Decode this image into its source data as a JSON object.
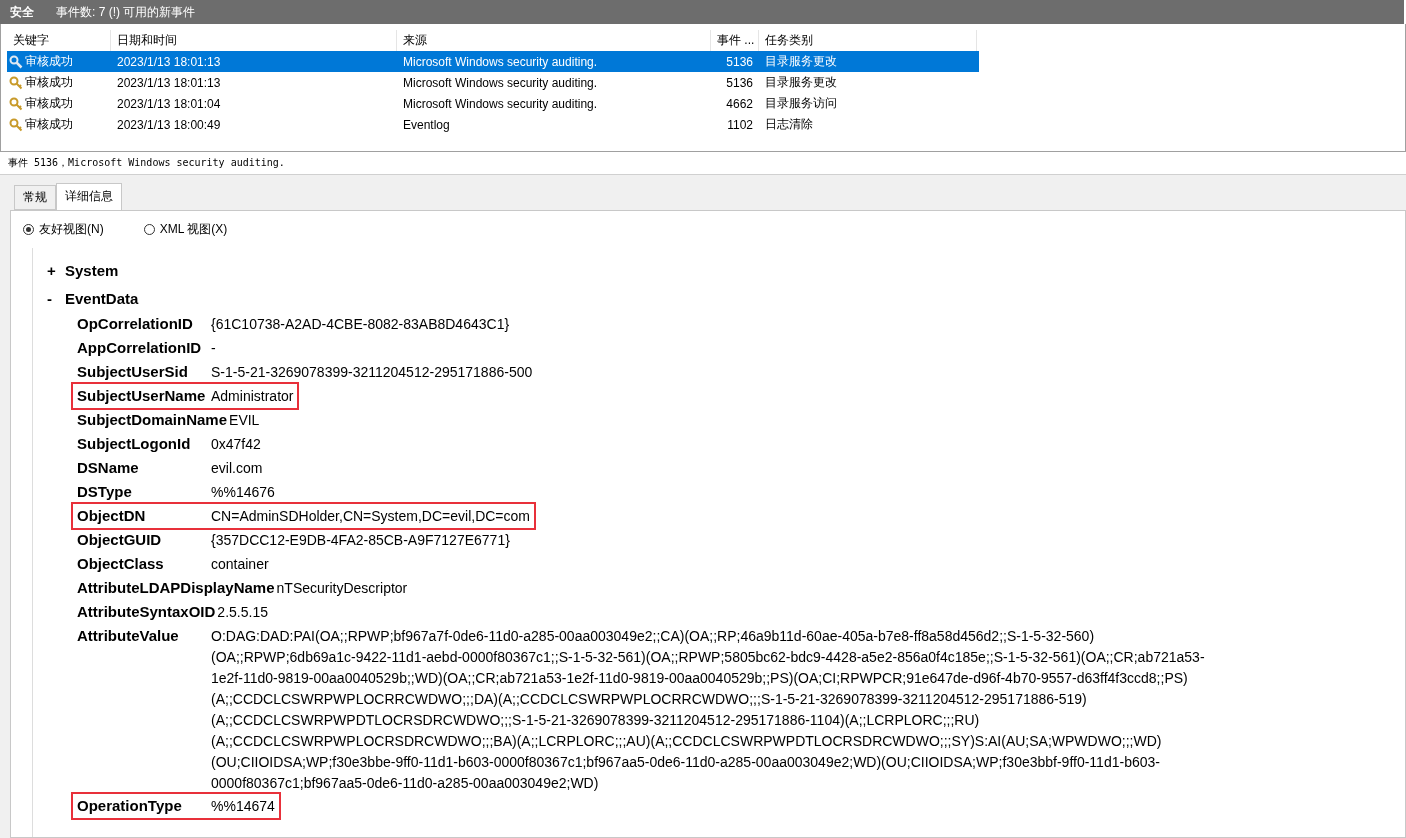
{
  "header": {
    "title": "安全",
    "summary": "事件数: 7 (!) 可用的新事件"
  },
  "table": {
    "columns": [
      "关键字",
      "日期和时间",
      "来源",
      "事件 ...",
      "任务类别"
    ],
    "rows": [
      {
        "keyword": "审核成功",
        "datetime": "2023/1/13 18:01:13",
        "source": "Microsoft Windows security auditing.",
        "event_id": "5136",
        "category": "目录服务更改",
        "selected": true
      },
      {
        "keyword": "审核成功",
        "datetime": "2023/1/13 18:01:13",
        "source": "Microsoft Windows security auditing.",
        "event_id": "5136",
        "category": "目录服务更改",
        "selected": false
      },
      {
        "keyword": "审核成功",
        "datetime": "2023/1/13 18:01:04",
        "source": "Microsoft Windows security auditing.",
        "event_id": "4662",
        "category": "目录服务访问",
        "selected": false
      },
      {
        "keyword": "审核成功",
        "datetime": "2023/1/13 18:00:49",
        "source": "Eventlog",
        "event_id": "1102",
        "category": "日志清除",
        "selected": false
      }
    ]
  },
  "detail_title": "事件 5136，Microsoft Windows security auditing.",
  "tabs": [
    {
      "label": "常规",
      "selected": false
    },
    {
      "label": "详细信息",
      "selected": true
    }
  ],
  "view_options": [
    {
      "label": "友好视图(N)",
      "selected": true
    },
    {
      "label": "XML 视图(X)",
      "selected": false
    }
  ],
  "tree": [
    {
      "toggle": "+",
      "label": "System"
    },
    {
      "toggle": "-",
      "label": "EventData",
      "fields": [
        {
          "name": "OpCorrelationID",
          "value": [
            "{61C10738-A2AD-4CBE-8082-83AB8D4643C1}"
          ],
          "highlighted": false
        },
        {
          "name": "AppCorrelationID",
          "value": [
            "-"
          ],
          "highlighted": false
        },
        {
          "name": "SubjectUserSid",
          "value": [
            "S-1-5-21-3269078399-3211204512-295171886-500"
          ],
          "highlighted": false
        },
        {
          "name": "SubjectUserName",
          "value": [
            "Administrator"
          ],
          "highlighted": true
        },
        {
          "name": "SubjectDomainName",
          "value": [
            "EVIL"
          ],
          "highlighted": false
        },
        {
          "name": "SubjectLogonId",
          "value": [
            "0x47f42"
          ],
          "highlighted": false
        },
        {
          "name": "DSName",
          "value": [
            "evil.com"
          ],
          "highlighted": false
        },
        {
          "name": "DSType",
          "value": [
            "%%14676"
          ],
          "highlighted": false
        },
        {
          "name": "ObjectDN",
          "value": [
            "CN=AdminSDHolder,CN=System,DC=evil,DC=com"
          ],
          "highlighted": true
        },
        {
          "name": "ObjectGUID",
          "value": [
            "{357DCC12-E9DB-4FA2-85CB-A9F7127E6771}"
          ],
          "highlighted": false
        },
        {
          "name": "ObjectClass",
          "value": [
            "container"
          ],
          "highlighted": false
        },
        {
          "name": "AttributeLDAPDisplayName",
          "value": [
            "nTSecurityDescriptor"
          ],
          "highlighted": false
        },
        {
          "name": "AttributeSyntaxOID",
          "value": [
            "2.5.5.15"
          ],
          "highlighted": false
        },
        {
          "name": "AttributeValue",
          "value": [
            "O:DAG:DAD:PAI(OA;;RPWP;bf967a7f-0de6-11d0-a285-00aa003049e2;;CA)(OA;;RP;46a9b11d-60ae-405a-b7e8-ff8a58d456d2;;S-1-5-32-560)",
            "(OA;;RPWP;6db69a1c-9422-11d1-aebd-0000f80367c1;;S-1-5-32-561)(OA;;RPWP;5805bc62-bdc9-4428-a5e2-856a0f4c185e;;S-1-5-32-561)(OA;;CR;ab721a53-",
            "1e2f-11d0-9819-00aa0040529b;;WD)(OA;;CR;ab721a53-1e2f-11d0-9819-00aa0040529b;;PS)(OA;CI;RPWPCR;91e647de-d96f-4b70-9557-d63ff4f3ccd8;;PS)",
            "(A;;CCDCLCSWRPWPLOCRRCWDWO;;;DA)(A;;CCDCLCSWRPWPLOCRRCWDWO;;;S-1-5-21-3269078399-3211204512-295171886-519)",
            "(A;;CCDCLCSWRPWPDTLOCRSDRCWDWO;;;S-1-5-21-3269078399-3211204512-295171886-1104)(A;;LCRPLORC;;;RU)",
            "(A;;CCDCLCSWRPWPLOCRSDRCWDWO;;;BA)(A;;LCRPLORC;;;AU)(A;;CCDCLCSWRPWPDTLOCRSDRCWDWO;;;SY)S:AI(AU;SA;WPWDWO;;;WD)",
            "(OU;CIIOIDSA;WP;f30e3bbe-9ff0-11d1-b603-0000f80367c1;bf967aa5-0de6-11d0-a285-00aa003049e2;WD)(OU;CIIOIDSA;WP;f30e3bbf-9ff0-11d1-b603-",
            "0000f80367c1;bf967aa5-0de6-11d0-a285-00aa003049e2;WD)"
          ],
          "highlighted": false
        },
        {
          "name": "OperationType",
          "value": [
            "%%14674"
          ],
          "highlighted": true
        }
      ]
    }
  ]
}
